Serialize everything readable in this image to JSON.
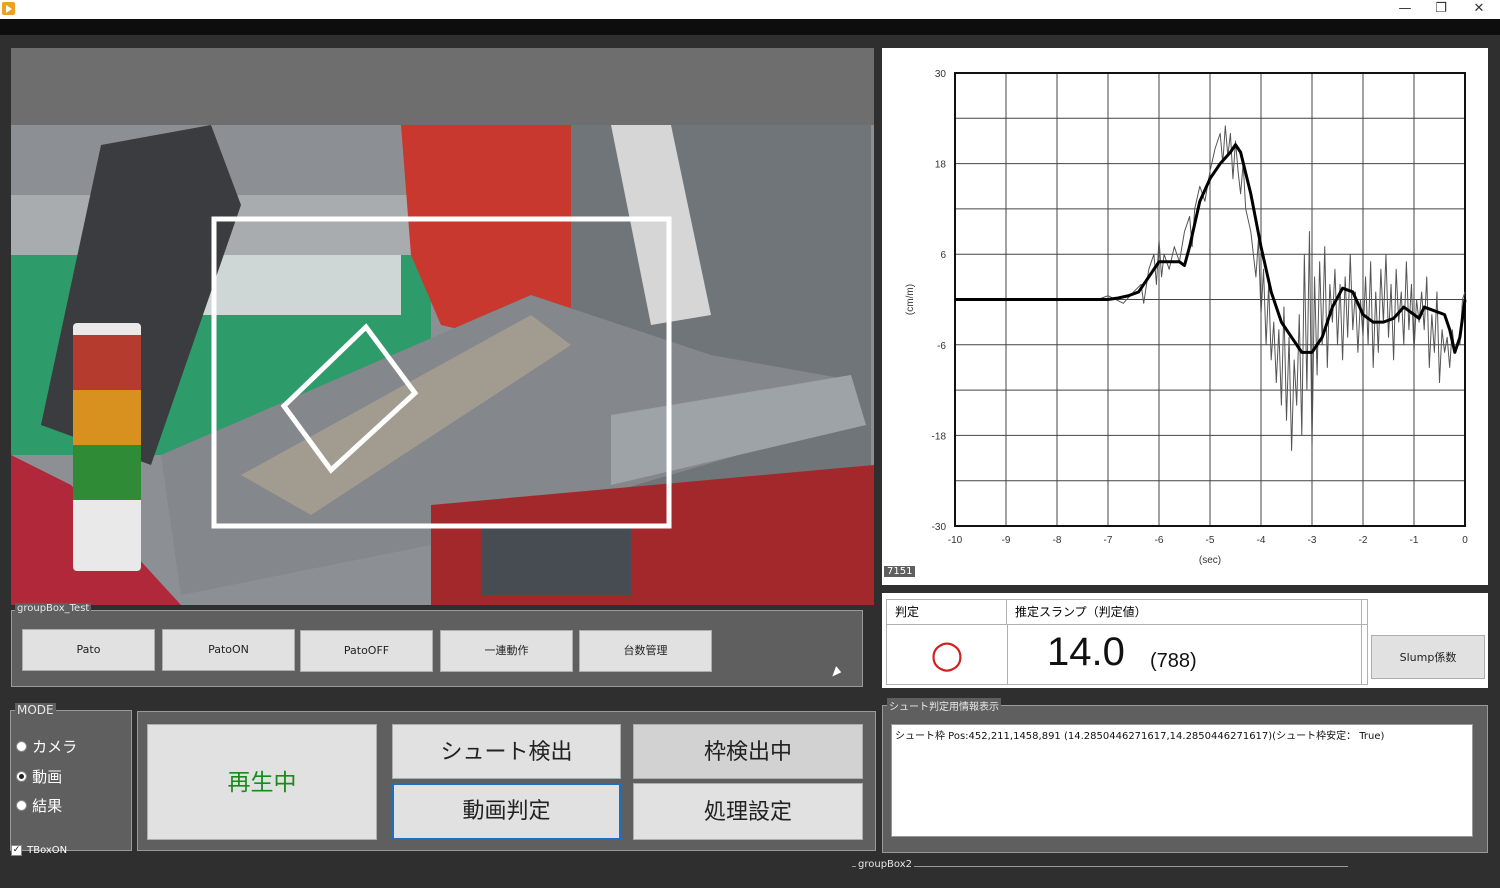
{
  "window": {
    "minimize": "—",
    "restore": "❐",
    "close": "✕"
  },
  "groupbox_test": {
    "label": "groupBox_Test",
    "buttons": [
      "Pato",
      "PatoON",
      "PatoOFF",
      "一連動作",
      "台数管理"
    ]
  },
  "mode": {
    "label": "MODE",
    "options": [
      "カメラ",
      "動画",
      "結果"
    ],
    "selected": "動画",
    "tbox_label": "TBoxON",
    "tbox_checked": true
  },
  "controls": {
    "playing_label": "再生中",
    "chute_detect": "シュート検出",
    "frame_detecting": "枠検出中",
    "video_judge": "動画判定",
    "process_settings": "処理設定"
  },
  "judgement": {
    "col1_header": "判定",
    "col2_header": "推定スランプ（判定値）",
    "result_symbol": "○",
    "slump_value": "14.0",
    "slump_raw": "(788)",
    "slump_coef_button": "Slump係数"
  },
  "chute_info": {
    "label": "シュート判定用情報表示",
    "text": "シュート枠 Pos:452,211,1458,891 (14.2850446271617,14.2850446271617)(シュート枠安定： True)"
  },
  "groupbox2_label": "groupBox2",
  "frame_counter": "7151",
  "colors": {
    "accent_green": "#1a8a1a",
    "judge_red": "#d02020",
    "chute_box": "#ffffff"
  },
  "chart_data": {
    "type": "line",
    "xlabel": "(sec)",
    "ylabel": "(cm/m)",
    "xlim": [
      -10,
      0
    ],
    "ylim": [
      -30,
      30
    ],
    "xticks": [
      -10,
      -9,
      -8,
      -7,
      -6,
      -5,
      -4,
      -3,
      -2,
      -1,
      0
    ],
    "yticks": [
      30,
      18,
      6,
      -6,
      -18,
      -30
    ],
    "grid": true,
    "series": [
      {
        "style": "thin",
        "x": [
          -10,
          -7.2,
          -7,
          -6.7,
          -6.5,
          -6.35,
          -6.3,
          -6.2,
          -6.1,
          -6.05,
          -6.0,
          -5.95,
          -5.9,
          -5.8,
          -5.7,
          -5.6,
          -5.5,
          -5.4,
          -5.35,
          -5.3,
          -5.2,
          -5.1,
          -5.0,
          -4.9,
          -4.8,
          -4.75,
          -4.7,
          -4.65,
          -4.6,
          -4.55,
          -4.5,
          -4.45,
          -4.4,
          -4.35,
          -4.3,
          -4.2,
          -4.1,
          -4.05,
          -4.0,
          -3.95,
          -3.9,
          -3.85,
          -3.8,
          -3.75,
          -3.7,
          -3.65,
          -3.6,
          -3.55,
          -3.5,
          -3.45,
          -3.4,
          -3.35,
          -3.3,
          -3.25,
          -3.2,
          -3.15,
          -3.1,
          -3.05,
          -3.0,
          -2.95,
          -2.9,
          -2.85,
          -2.8,
          -2.75,
          -2.7,
          -2.65,
          -2.6,
          -2.55,
          -2.5,
          -2.45,
          -2.4,
          -2.35,
          -2.3,
          -2.25,
          -2.2,
          -2.15,
          -2.1,
          -2.05,
          -2.0,
          -1.95,
          -1.9,
          -1.85,
          -1.8,
          -1.75,
          -1.7,
          -1.65,
          -1.6,
          -1.55,
          -1.5,
          -1.45,
          -1.4,
          -1.35,
          -1.3,
          -1.25,
          -1.2,
          -1.15,
          -1.1,
          -1.05,
          -1.0,
          -0.95,
          -0.9,
          -0.85,
          -0.8,
          -0.75,
          -0.7,
          -0.65,
          -0.6,
          -0.55,
          -0.5,
          -0.45,
          -0.4,
          -0.35,
          -0.3,
          -0.25,
          -0.2,
          -0.15,
          -0.1,
          -0.05,
          0
        ],
        "y": [
          0,
          0,
          0.5,
          -0.5,
          1,
          2,
          -0.5,
          4,
          6,
          2,
          8,
          3,
          6,
          4,
          7,
          5,
          9,
          11,
          7,
          12,
          15,
          13,
          17,
          20,
          22,
          18,
          23,
          19,
          22,
          16,
          21,
          17,
          14,
          18,
          12,
          9,
          3,
          8,
          -2,
          4,
          -6,
          2,
          -8,
          -3,
          -11,
          -4,
          -14,
          -1,
          -16,
          -5,
          -20,
          -8,
          -14,
          -2,
          -18,
          6,
          -12,
          9,
          -20,
          3,
          -10,
          5,
          -6,
          7,
          -9,
          2,
          -3,
          4,
          -6,
          2,
          -8,
          3,
          -5,
          6,
          -4,
          1,
          -7,
          0,
          -5,
          3,
          -6,
          5,
          -9,
          1,
          -7,
          4,
          -3,
          6,
          -5,
          2,
          -8,
          4,
          -3,
          1,
          -6,
          5,
          -4,
          2,
          -7,
          0,
          -3,
          1,
          -4,
          3,
          -9,
          -2,
          -7,
          1,
          -11,
          -4,
          -7,
          -5,
          -9,
          -4,
          -7,
          -6,
          -6,
          0,
          1
        ]
      },
      {
        "style": "thick",
        "x": [
          -10,
          -7,
          -6.8,
          -6.6,
          -6.4,
          -6.2,
          -6.0,
          -5.8,
          -5.6,
          -5.5,
          -5.4,
          -5.3,
          -5.2,
          -5.0,
          -4.8,
          -4.6,
          -4.5,
          -4.4,
          -4.2,
          -4.0,
          -3.8,
          -3.6,
          -3.4,
          -3.2,
          -3.0,
          -2.8,
          -2.6,
          -2.4,
          -2.2,
          -2.0,
          -1.8,
          -1.6,
          -1.4,
          -1.2,
          -1.0,
          -0.9,
          -0.8,
          -0.6,
          -0.4,
          -0.3,
          -0.2,
          -0.1,
          0
        ],
        "y": [
          0,
          0,
          0.2,
          0.5,
          1,
          3,
          5,
          5,
          5,
          4.5,
          7,
          10,
          13,
          16,
          18,
          19.5,
          20.5,
          19.5,
          14,
          7,
          1,
          -3,
          -5,
          -7,
          -7,
          -5,
          -1,
          1.5,
          1,
          -2,
          -3,
          -3,
          -2.5,
          -1,
          -2,
          -2.5,
          -1,
          -1.5,
          -2,
          -4,
          -7,
          -5,
          0
        ]
      }
    ]
  }
}
